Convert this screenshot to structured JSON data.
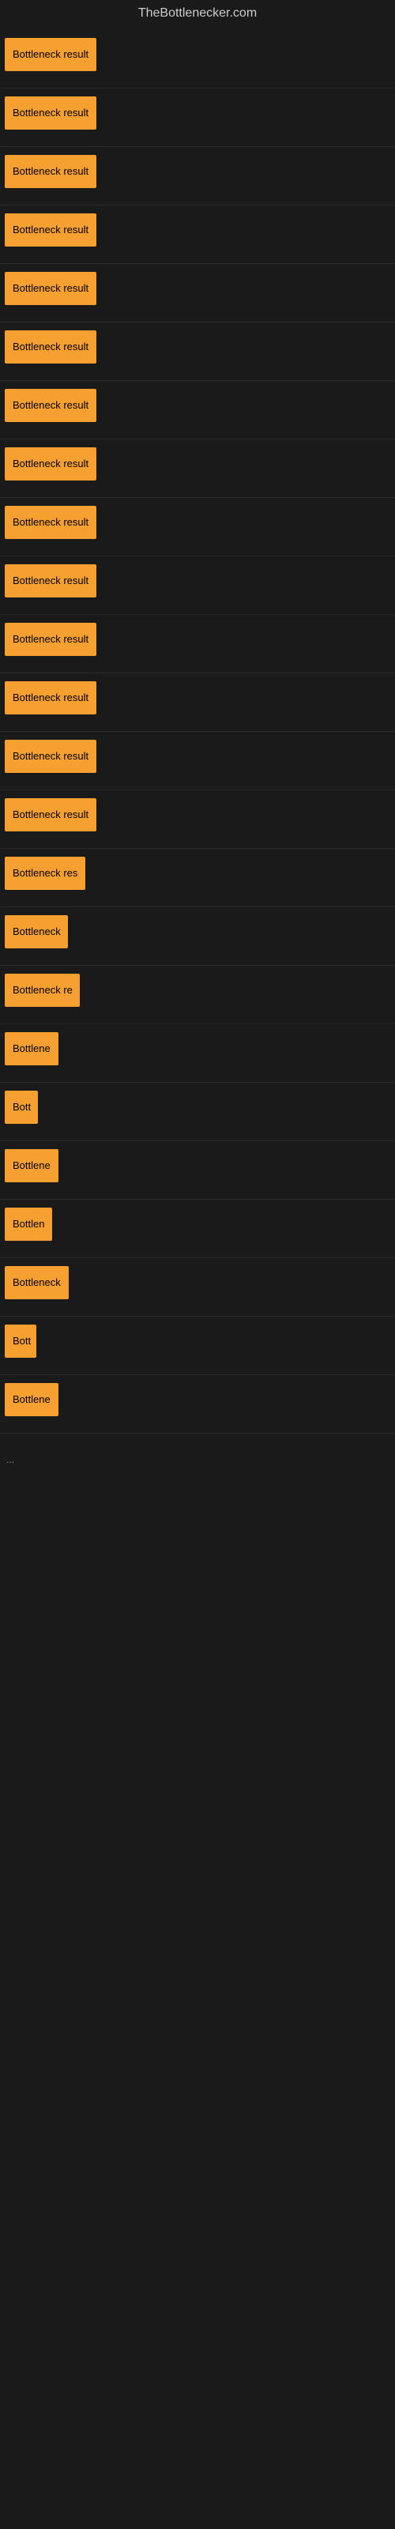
{
  "site": {
    "title": "TheBottlenecker.com"
  },
  "items": [
    {
      "id": 1,
      "label": "Bottleneck result",
      "width": 135
    },
    {
      "id": 2,
      "label": "Bottleneck result",
      "width": 135
    },
    {
      "id": 3,
      "label": "Bottleneck result",
      "width": 135
    },
    {
      "id": 4,
      "label": "Bottleneck result",
      "width": 135
    },
    {
      "id": 5,
      "label": "Bottleneck result",
      "width": 135
    },
    {
      "id": 6,
      "label": "Bottleneck result",
      "width": 135
    },
    {
      "id": 7,
      "label": "Bottleneck result",
      "width": 135
    },
    {
      "id": 8,
      "label": "Bottleneck result",
      "width": 135
    },
    {
      "id": 9,
      "label": "Bottleneck result",
      "width": 135
    },
    {
      "id": 10,
      "label": "Bottleneck result",
      "width": 135
    },
    {
      "id": 11,
      "label": "Bottleneck result",
      "width": 135
    },
    {
      "id": 12,
      "label": "Bottleneck result",
      "width": 135
    },
    {
      "id": 13,
      "label": "Bottleneck result",
      "width": 135
    },
    {
      "id": 14,
      "label": "Bottleneck result",
      "width": 135
    },
    {
      "id": 15,
      "label": "Bottleneck res",
      "width": 110
    },
    {
      "id": 16,
      "label": "Bottleneck",
      "width": 80
    },
    {
      "id": 17,
      "label": "Bottleneck re",
      "width": 95
    },
    {
      "id": 18,
      "label": "Bottlene",
      "width": 72
    },
    {
      "id": 19,
      "label": "Bott",
      "width": 42
    },
    {
      "id": 20,
      "label": "Bottlene",
      "width": 72
    },
    {
      "id": 21,
      "label": "Bottlen",
      "width": 65
    },
    {
      "id": 22,
      "label": "Bottleneck",
      "width": 82
    },
    {
      "id": 23,
      "label": "Bott",
      "width": 40
    },
    {
      "id": 24,
      "label": "Bottlene",
      "width": 72
    }
  ],
  "ellipsis": "...",
  "colors": {
    "badge_bg": "#f5a030",
    "badge_text": "#000000",
    "page_bg": "#1a1a1a",
    "title_text": "#cccccc"
  }
}
